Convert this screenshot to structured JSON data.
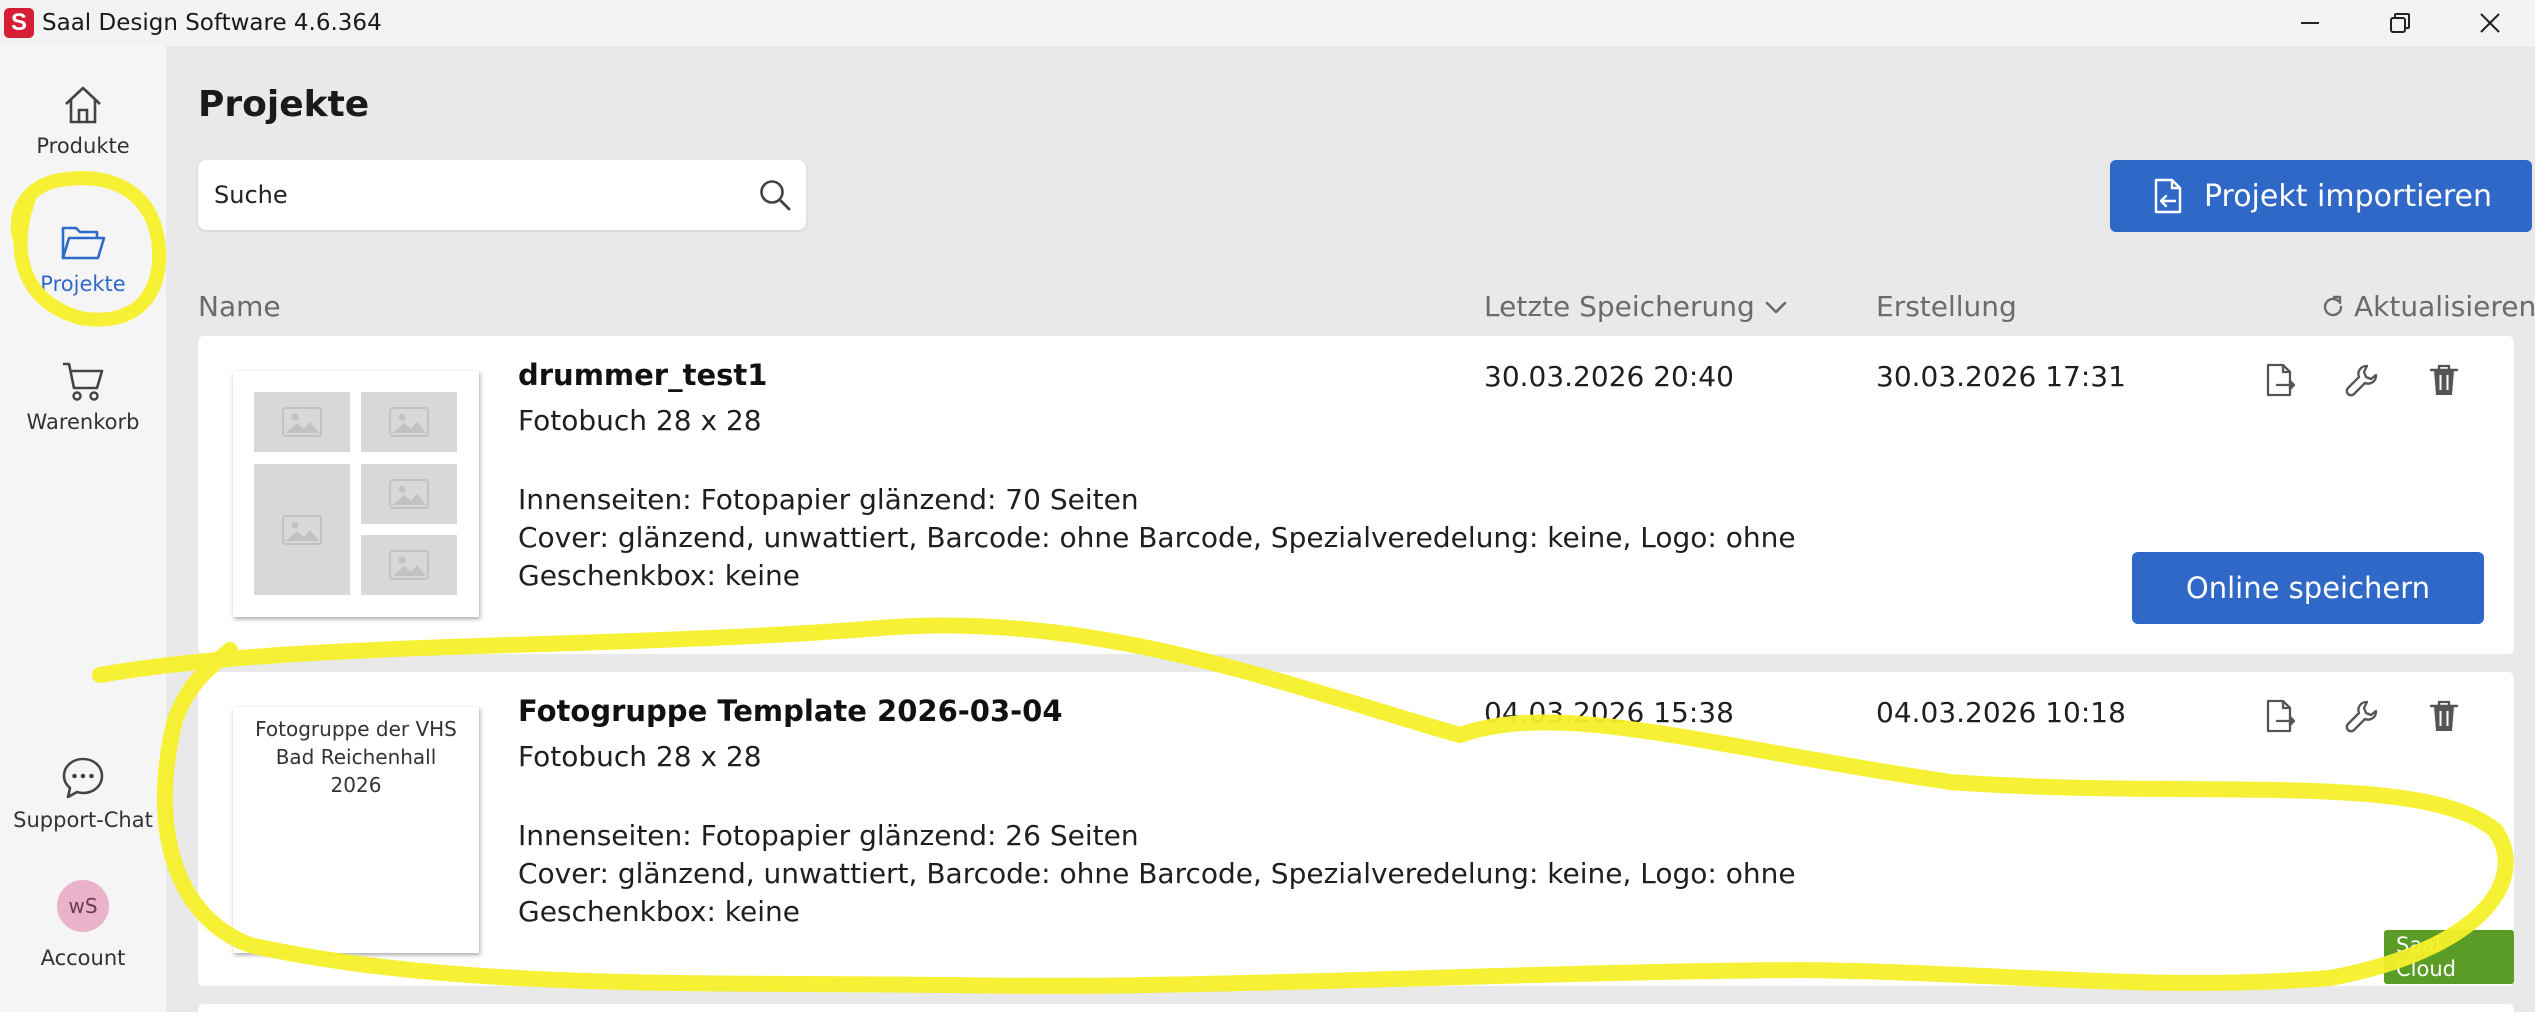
{
  "window": {
    "title": "Saal Design Software 4.6.364",
    "logo_letter": "S"
  },
  "sidebar": {
    "items": [
      {
        "label": "Produkte",
        "icon": "home-icon"
      },
      {
        "label": "Projekte",
        "icon": "folder-open-icon",
        "active": true
      },
      {
        "label": "Warenkorb",
        "icon": "cart-icon"
      },
      {
        "label": "Support-Chat",
        "icon": "chat-icon"
      },
      {
        "label": "Account",
        "icon": "avatar",
        "initials": "wS"
      }
    ]
  },
  "main": {
    "title": "Projekte",
    "search": {
      "placeholder": "Suche",
      "value": ""
    },
    "import_label": "Projekt importieren",
    "columns": {
      "name": "Name",
      "last_saved": "Letzte Speicherung",
      "created": "Erstellung",
      "refresh": "Aktualisieren"
    },
    "projects": [
      {
        "name": "drummer_test1",
        "product": "Fotobuch 28 x 28",
        "details": [
          "Innenseiten: Fotopapier glänzend: 70 Seiten",
          "Cover: glänzend, unwattiert, Barcode: ohne Barcode, Spezialveredelung: keine, Logo: ohne",
          "Geschenkbox: keine"
        ],
        "last_saved": "30.03.2026 20:40",
        "created": "30.03.2026 17:31",
        "online_save_label": "Online speichern"
      },
      {
        "name": "Fotogruppe Template 2026-03-04",
        "product": "Fotobuch 28 x 28",
        "thumb_text": [
          "Fotogruppe der VHS",
          "Bad Reichenhall",
          "2026"
        ],
        "details": [
          "Innenseiten: Fotopapier glänzend: 26 Seiten",
          "Cover: glänzend, unwattiert, Barcode: ohne Barcode, Spezialveredelung: keine, Logo: ohne",
          "Geschenkbox: keine"
        ],
        "last_saved": "04.03.2026 15:38",
        "created": "04.03.2026 10:18",
        "badge": "Saal Cloud"
      }
    ]
  },
  "colors": {
    "accent": "#3068c8",
    "brand": "#d61f35",
    "cloud_badge": "#5a9c26",
    "highlight": "#f5f02a"
  }
}
